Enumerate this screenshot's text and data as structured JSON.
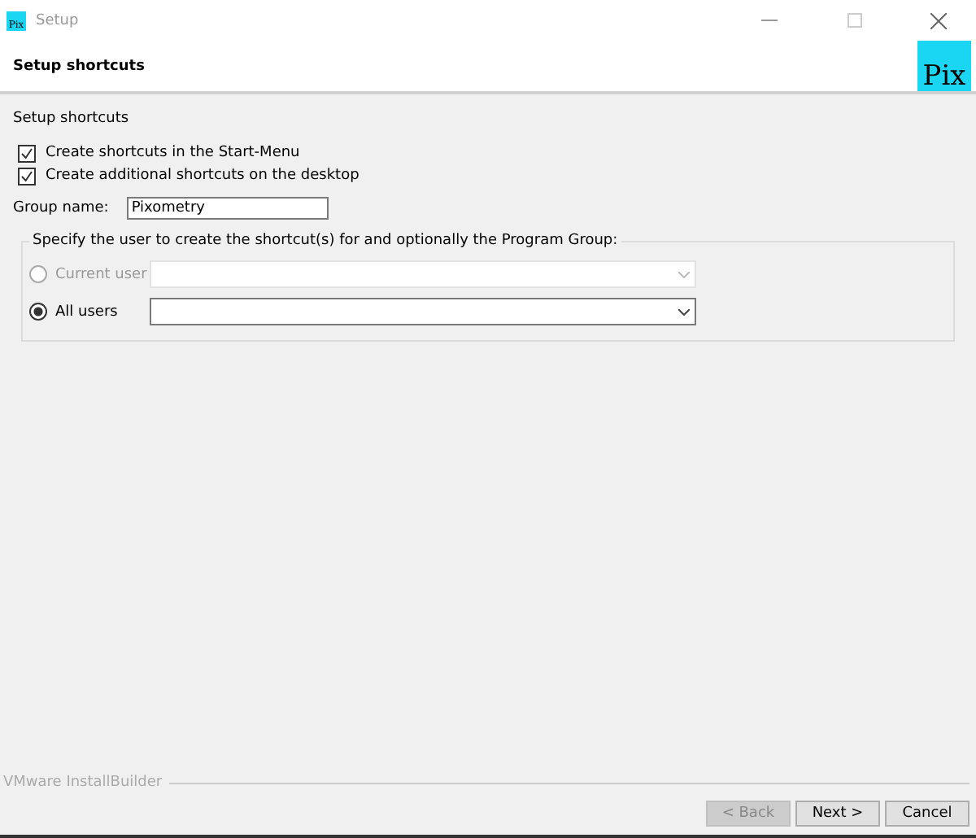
{
  "window": {
    "title": "Setup",
    "logo": "Pix"
  },
  "header": {
    "title": "Setup shortcuts",
    "logo": "Pix"
  },
  "section_title": "Setup shortcuts",
  "checkboxes": [
    {
      "label": "Create shortcuts in the Start-Menu",
      "checked": true
    },
    {
      "label": "Create additional shortcuts on the desktop",
      "checked": true
    }
  ],
  "group_name": {
    "label": "Group name:",
    "value": "Pixometry"
  },
  "user_group": {
    "legend": "Specify the user to create the shortcut(s) for and optionally the Program Group:",
    "options": [
      {
        "label": "Current user",
        "selected": false,
        "disabled": true
      },
      {
        "label": "All users",
        "selected": true,
        "disabled": false
      }
    ]
  },
  "footer": {
    "brand": "VMware InstallBuilder",
    "buttons": [
      {
        "label": "< Back",
        "disabled": true
      },
      {
        "label": "Next >",
        "disabled": false
      },
      {
        "label": "Cancel",
        "disabled": false
      }
    ]
  }
}
